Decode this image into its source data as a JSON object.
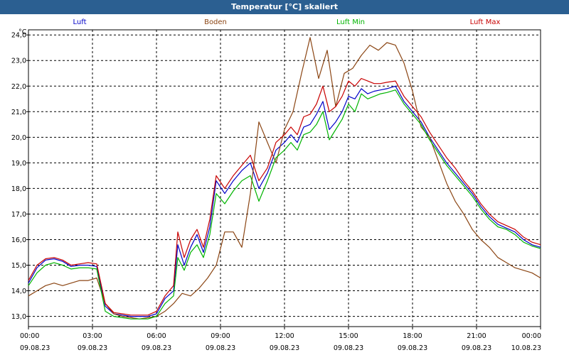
{
  "title": "Temperatur [°C] skaliert",
  "chart_data": {
    "type": "line",
    "title": "Temperatur [°C] skaliert",
    "ylabel": "°C",
    "xlabel": "",
    "ylim": [
      12.6,
      24.2
    ],
    "y_ticks": [
      "13,0",
      "14,0",
      "15,0",
      "16,0",
      "17,0",
      "18,0",
      "19,0",
      "20,0",
      "21,0",
      "22,0",
      "23,0",
      "24,0"
    ],
    "x_ticks": [
      {
        "hour": 0,
        "time": "00:00",
        "date": "09.08.23"
      },
      {
        "hour": 3,
        "time": "03:00",
        "date": "09.08.23"
      },
      {
        "hour": 6,
        "time": "06:00",
        "date": "09.08.23"
      },
      {
        "hour": 9,
        "time": "09:00",
        "date": "09.08.23"
      },
      {
        "hour": 12,
        "time": "12:00",
        "date": "09.08.23"
      },
      {
        "hour": 15,
        "time": "15:00",
        "date": "09.08.23"
      },
      {
        "hour": 18,
        "time": "18:00",
        "date": "09.08.23"
      },
      {
        "hour": 21,
        "time": "21:00",
        "date": "09.08.23"
      },
      {
        "hour": 24,
        "time": "00:00",
        "date": "10.08.23"
      }
    ],
    "grid": true,
    "legend_position": "top",
    "series": [
      {
        "name": "Luft",
        "color": "#0000c8",
        "x": [
          0,
          0.4,
          0.8,
          1.2,
          1.6,
          2.0,
          2.4,
          2.8,
          3.2,
          3.6,
          4.0,
          4.4,
          4.8,
          5.2,
          5.6,
          6.0,
          6.4,
          6.8,
          7.0,
          7.3,
          7.6,
          7.9,
          8.2,
          8.5,
          8.8,
          9.2,
          9.6,
          10.0,
          10.4,
          10.8,
          11.2,
          11.6,
          12.0,
          12.3,
          12.6,
          12.9,
          13.2,
          13.5,
          13.8,
          14.1,
          14.4,
          14.7,
          15.0,
          15.3,
          15.6,
          15.9,
          16.2,
          16.5,
          16.8,
          17.2,
          17.6,
          18.0,
          18.4,
          18.8,
          19.2,
          19.6,
          20.0,
          20.4,
          20.8,
          21.2,
          21.6,
          22.0,
          22.4,
          22.8,
          23.2,
          23.6,
          24.0
        ],
        "y": [
          14.3,
          14.9,
          15.2,
          15.25,
          15.15,
          14.95,
          15.0,
          15.0,
          14.95,
          13.4,
          13.1,
          13.05,
          13.0,
          13.0,
          13.0,
          13.1,
          13.7,
          14.0,
          15.8,
          15.0,
          15.7,
          16.2,
          15.5,
          16.5,
          18.3,
          17.8,
          18.3,
          18.7,
          19.0,
          18.0,
          18.6,
          19.5,
          19.8,
          20.1,
          19.8,
          20.4,
          20.5,
          20.9,
          21.4,
          20.3,
          20.6,
          21.0,
          21.6,
          21.5,
          21.9,
          21.7,
          21.8,
          21.85,
          21.9,
          22.0,
          21.4,
          21.0,
          20.6,
          20.0,
          19.5,
          19.0,
          18.6,
          18.2,
          17.8,
          17.3,
          16.9,
          16.6,
          16.45,
          16.3,
          16.0,
          15.8,
          15.7
        ]
      },
      {
        "name": "Boden",
        "color": "#8b4513",
        "x": [
          0,
          0.4,
          0.8,
          1.2,
          1.6,
          2.0,
          2.4,
          2.8,
          3.2,
          3.6,
          4.0,
          4.4,
          4.8,
          5.2,
          5.6,
          6.0,
          6.4,
          6.8,
          7.2,
          7.6,
          8.0,
          8.4,
          8.8,
          9.2,
          9.6,
          10.0,
          10.4,
          10.8,
          11.2,
          11.6,
          12.0,
          12.4,
          12.8,
          13.2,
          13.6,
          14.0,
          14.4,
          14.8,
          15.2,
          15.6,
          16.0,
          16.4,
          16.8,
          17.2,
          17.6,
          18.0,
          18.4,
          18.8,
          19.2,
          19.6,
          20.0,
          20.4,
          20.8,
          21.2,
          21.6,
          22.0,
          22.4,
          22.8,
          23.2,
          23.6,
          24.0
        ],
        "y": [
          13.8,
          14.0,
          14.2,
          14.3,
          14.2,
          14.3,
          14.4,
          14.4,
          14.5,
          13.5,
          13.1,
          13.0,
          12.95,
          12.9,
          12.95,
          13.0,
          13.2,
          13.5,
          13.9,
          13.8,
          14.1,
          14.5,
          15.0,
          16.3,
          16.3,
          15.7,
          17.8,
          20.6,
          19.8,
          19.0,
          20.3,
          21.0,
          22.5,
          23.9,
          22.3,
          23.4,
          21.2,
          22.5,
          22.7,
          23.2,
          23.6,
          23.4,
          23.7,
          23.6,
          22.9,
          21.8,
          20.4,
          20.0,
          19.1,
          18.2,
          17.5,
          17.0,
          16.4,
          16.0,
          15.7,
          15.3,
          15.1,
          14.9,
          14.8,
          14.7,
          14.5
        ]
      },
      {
        "name": "Luft Min",
        "color": "#00b400",
        "x": [
          0,
          0.4,
          0.8,
          1.2,
          1.6,
          2.0,
          2.4,
          2.8,
          3.2,
          3.6,
          4.0,
          4.4,
          4.8,
          5.2,
          5.6,
          6.0,
          6.4,
          6.8,
          7.0,
          7.3,
          7.6,
          7.9,
          8.2,
          8.5,
          8.8,
          9.2,
          9.6,
          10.0,
          10.4,
          10.8,
          11.2,
          11.6,
          12.0,
          12.3,
          12.6,
          12.9,
          13.2,
          13.5,
          13.8,
          14.1,
          14.4,
          14.7,
          15.0,
          15.3,
          15.6,
          15.9,
          16.2,
          16.5,
          16.8,
          17.2,
          17.6,
          18.0,
          18.4,
          18.8,
          19.2,
          19.6,
          20.0,
          20.4,
          20.8,
          21.2,
          21.6,
          22.0,
          22.4,
          22.8,
          23.2,
          23.6,
          24.0
        ],
        "y": [
          14.2,
          14.7,
          15.0,
          15.1,
          15.0,
          14.85,
          14.9,
          14.9,
          14.85,
          13.2,
          13.0,
          12.95,
          12.9,
          12.9,
          12.9,
          13.0,
          13.5,
          13.8,
          15.3,
          14.8,
          15.5,
          15.8,
          15.3,
          16.2,
          17.8,
          17.4,
          17.9,
          18.3,
          18.5,
          17.5,
          18.3,
          19.2,
          19.5,
          19.8,
          19.5,
          20.1,
          20.2,
          20.5,
          21.0,
          19.9,
          20.3,
          20.7,
          21.3,
          21.0,
          21.7,
          21.5,
          21.6,
          21.7,
          21.75,
          21.85,
          21.3,
          20.9,
          20.5,
          19.9,
          19.4,
          18.9,
          18.5,
          18.1,
          17.7,
          17.2,
          16.8,
          16.5,
          16.4,
          16.2,
          15.9,
          15.75,
          15.65
        ]
      },
      {
        "name": "Luft Max",
        "color": "#c80000",
        "x": [
          0,
          0.4,
          0.8,
          1.2,
          1.6,
          2.0,
          2.4,
          2.8,
          3.2,
          3.6,
          4.0,
          4.4,
          4.8,
          5.2,
          5.6,
          6.0,
          6.4,
          6.8,
          7.0,
          7.3,
          7.6,
          7.9,
          8.2,
          8.5,
          8.8,
          9.2,
          9.6,
          10.0,
          10.4,
          10.8,
          11.2,
          11.6,
          12.0,
          12.3,
          12.6,
          12.9,
          13.2,
          13.5,
          13.8,
          14.1,
          14.4,
          14.7,
          15.0,
          15.3,
          15.6,
          15.9,
          16.2,
          16.5,
          16.8,
          17.2,
          17.6,
          18.0,
          18.4,
          18.8,
          19.2,
          19.6,
          20.0,
          20.4,
          20.8,
          21.2,
          21.6,
          22.0,
          22.4,
          22.8,
          23.2,
          23.6,
          24.0
        ],
        "y": [
          14.4,
          15.0,
          15.25,
          15.3,
          15.2,
          15.0,
          15.05,
          15.1,
          15.05,
          13.5,
          13.15,
          13.1,
          13.05,
          13.05,
          13.05,
          13.2,
          13.8,
          14.2,
          16.3,
          15.3,
          16.0,
          16.4,
          15.7,
          16.8,
          18.5,
          18.0,
          18.5,
          18.9,
          19.3,
          18.3,
          18.8,
          19.8,
          20.1,
          20.4,
          20.1,
          20.8,
          20.9,
          21.3,
          22.0,
          21.0,
          21.2,
          21.6,
          22.2,
          22.0,
          22.3,
          22.2,
          22.1,
          22.1,
          22.15,
          22.2,
          21.6,
          21.2,
          20.8,
          20.2,
          19.7,
          19.2,
          18.8,
          18.3,
          17.9,
          17.4,
          17.0,
          16.7,
          16.55,
          16.4,
          16.1,
          15.9,
          15.8
        ]
      }
    ]
  }
}
